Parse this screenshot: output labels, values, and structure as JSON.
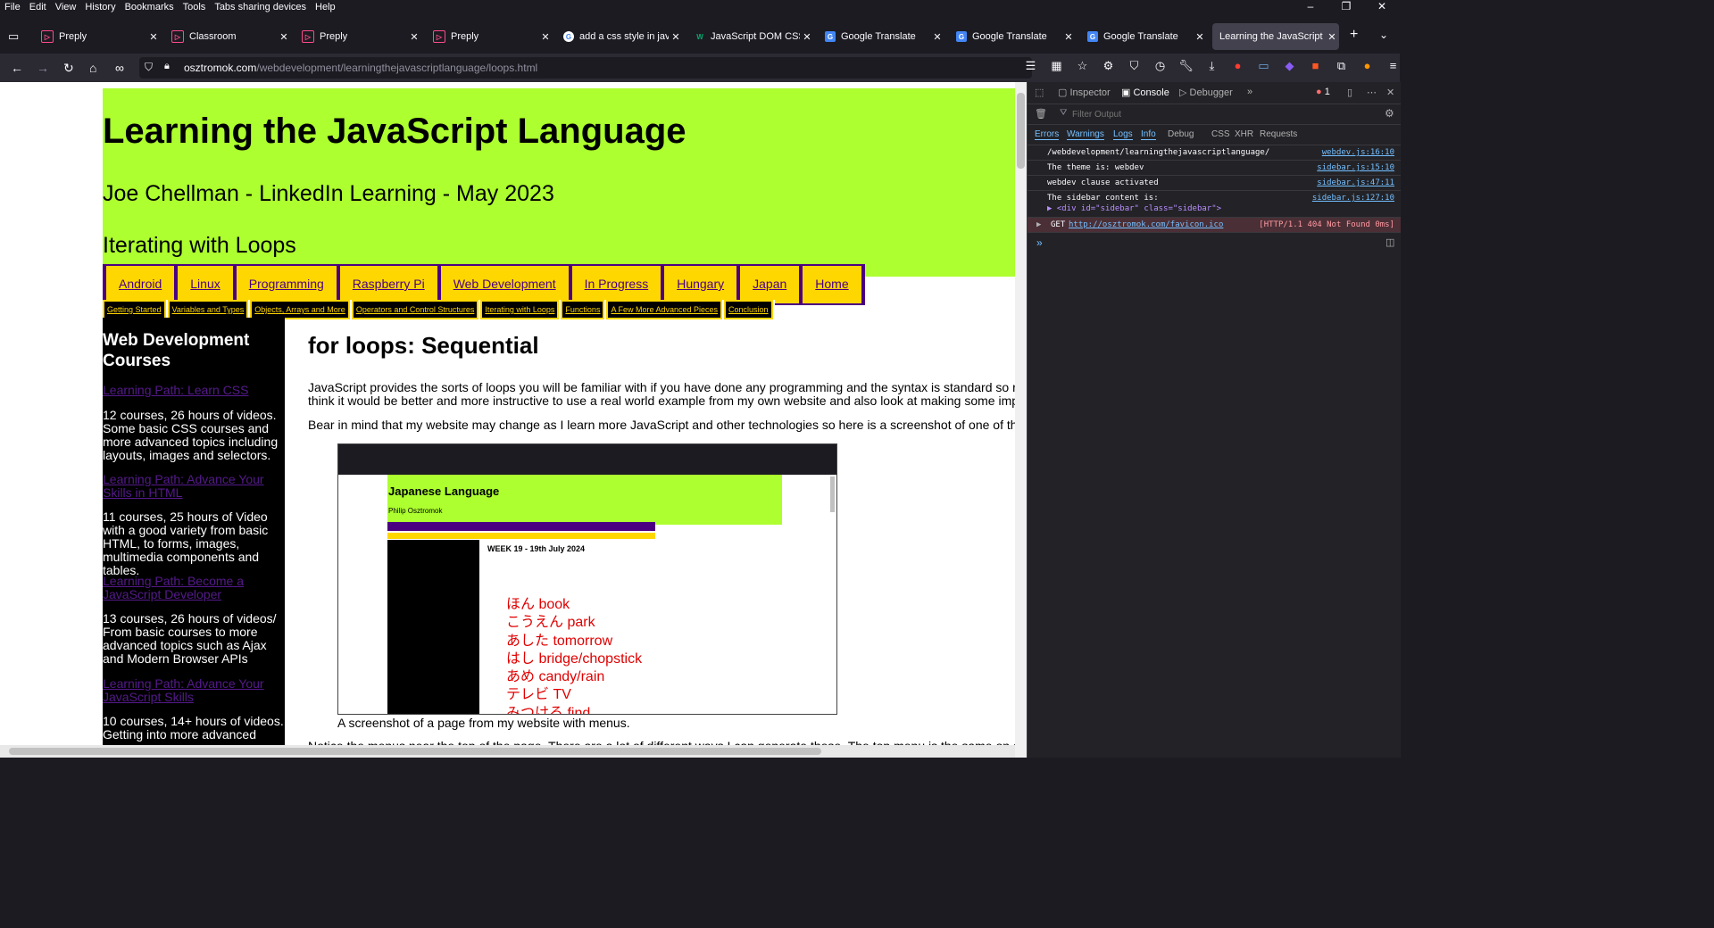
{
  "menu": [
    "File",
    "Edit",
    "View",
    "History",
    "Bookmarks",
    "Tools",
    "Tabs sharing devices",
    "Help"
  ],
  "window_controls": [
    "–",
    "❐",
    "✕"
  ],
  "tabs": [
    {
      "label": "Preply",
      "icon": "preply"
    },
    {
      "label": "Classroom",
      "icon": "preply"
    },
    {
      "label": "Preply",
      "icon": "preply"
    },
    {
      "label": "Preply",
      "icon": "preply"
    },
    {
      "label": "add a css style in javasc",
      "icon": "google"
    },
    {
      "label": "JavaScript DOM CSS",
      "icon": "w3"
    },
    {
      "label": "Google Translate",
      "icon": "translate"
    },
    {
      "label": "Google Translate",
      "icon": "translate"
    },
    {
      "label": "Google Translate",
      "icon": "translate"
    },
    {
      "label": "Learning the JavaScript Lan",
      "icon": "none"
    }
  ],
  "url": {
    "host": "osztromok.com",
    "path": "/webdevelopment/learningthejavascriptlanguage/loops.html"
  },
  "page": {
    "title": "Learning the JavaScript Language",
    "subtitle": "Joe Chellman - LinkedIn Learning - May 2023",
    "section": "Iterating with Loops",
    "topnav": [
      "Android",
      "Linux",
      "Programming",
      "Raspberry Pi",
      "Web Development",
      "In Progress",
      "Hungary",
      "Japan",
      "Home"
    ],
    "subnav": [
      "Getting Started",
      "Variables and Types",
      "Objects, Arrays and More",
      "Operators and Control Structures",
      "Iterating with Loops",
      "Functions",
      "A Few More Advanced Pieces",
      "Conclusion"
    ],
    "sidebar": {
      "heading": "Web Development Courses",
      "items": [
        {
          "link": "Learning Path: Learn CSS",
          "text": "12 courses, 26 hours of videos. Some basic CSS courses and more advanced topics including layouts, images and selectors."
        },
        {
          "link": "Learning Path: Advance Your Skills in HTML",
          "text": "11 courses, 25 hours of Video with a good variety from basic HTML, to forms, images, multimedia components and tables."
        },
        {
          "link": "Learning Path: Become a JavaScript Developer",
          "text": "13 courses, 26 hours of videos/ From basic courses to more advanced topics such as Ajax and Modern Browser APIs"
        },
        {
          "link": "Learning Path: Advance Your JavaScript Skills",
          "text": "10 courses, 14+ hours of videos. Getting into more advanced"
        }
      ]
    },
    "content": {
      "heading": "for loops: Sequential",
      "p1a": "JavaScript provides the sorts of loops you will be familiar with if you have done any programming and the syntax is standard so rather tha",
      "p1b": "think it would be better and more instructive to use a real world example from my own website and also look at making some improvemer",
      "p2": "Bear in mind that my website may change as I learn more JavaScript and other technologies so here is a screenshot of one of the pages",
      "caption": "A screenshot of a page from my website with menus.",
      "p3": "Notice the menus near the top of the page. There are a lot of different ways I can generate these. The top menu is the same on all of the"
    },
    "screenshot": {
      "title": "Japanese Language",
      "author": "Philip Osztromok",
      "heading": "WEEK 19 - 19th July 2024",
      "vocab": [
        "ほん book",
        "こうえん park",
        "あした tomorrow",
        "はし bridge/chopstick",
        "あめ candy/rain",
        "テレビ TV",
        "みつける find"
      ]
    }
  },
  "devtools": {
    "tabs": [
      "Inspector",
      "Console",
      "Debugger"
    ],
    "filter_placeholder": "Filter Output",
    "error_count": "1",
    "levels": [
      "Errors",
      "Warnings",
      "Logs",
      "Info",
      "Debug",
      "CSS",
      "XHR",
      "Requests"
    ],
    "logs": [
      {
        "msg": "/webdevelopment/learningthejavascriptlanguage/",
        "src": "webdev.js:16:10"
      },
      {
        "msg": "The theme is: webdev",
        "src": "sidebar.js:15:10"
      },
      {
        "msg": "webdev clause activated",
        "src": "sidebar.js:47:11"
      },
      {
        "msg": "The sidebar content is:",
        "msg2": "▶ <div id=\"sidebar\" class=\"sidebar\">",
        "src": "sidebar.js:127:10"
      }
    ],
    "error": {
      "method": "GET",
      "url": "http://osztromok.com/favicon.ico",
      "status": "[HTTP/1.1 404 Not Found 0ms]"
    }
  }
}
